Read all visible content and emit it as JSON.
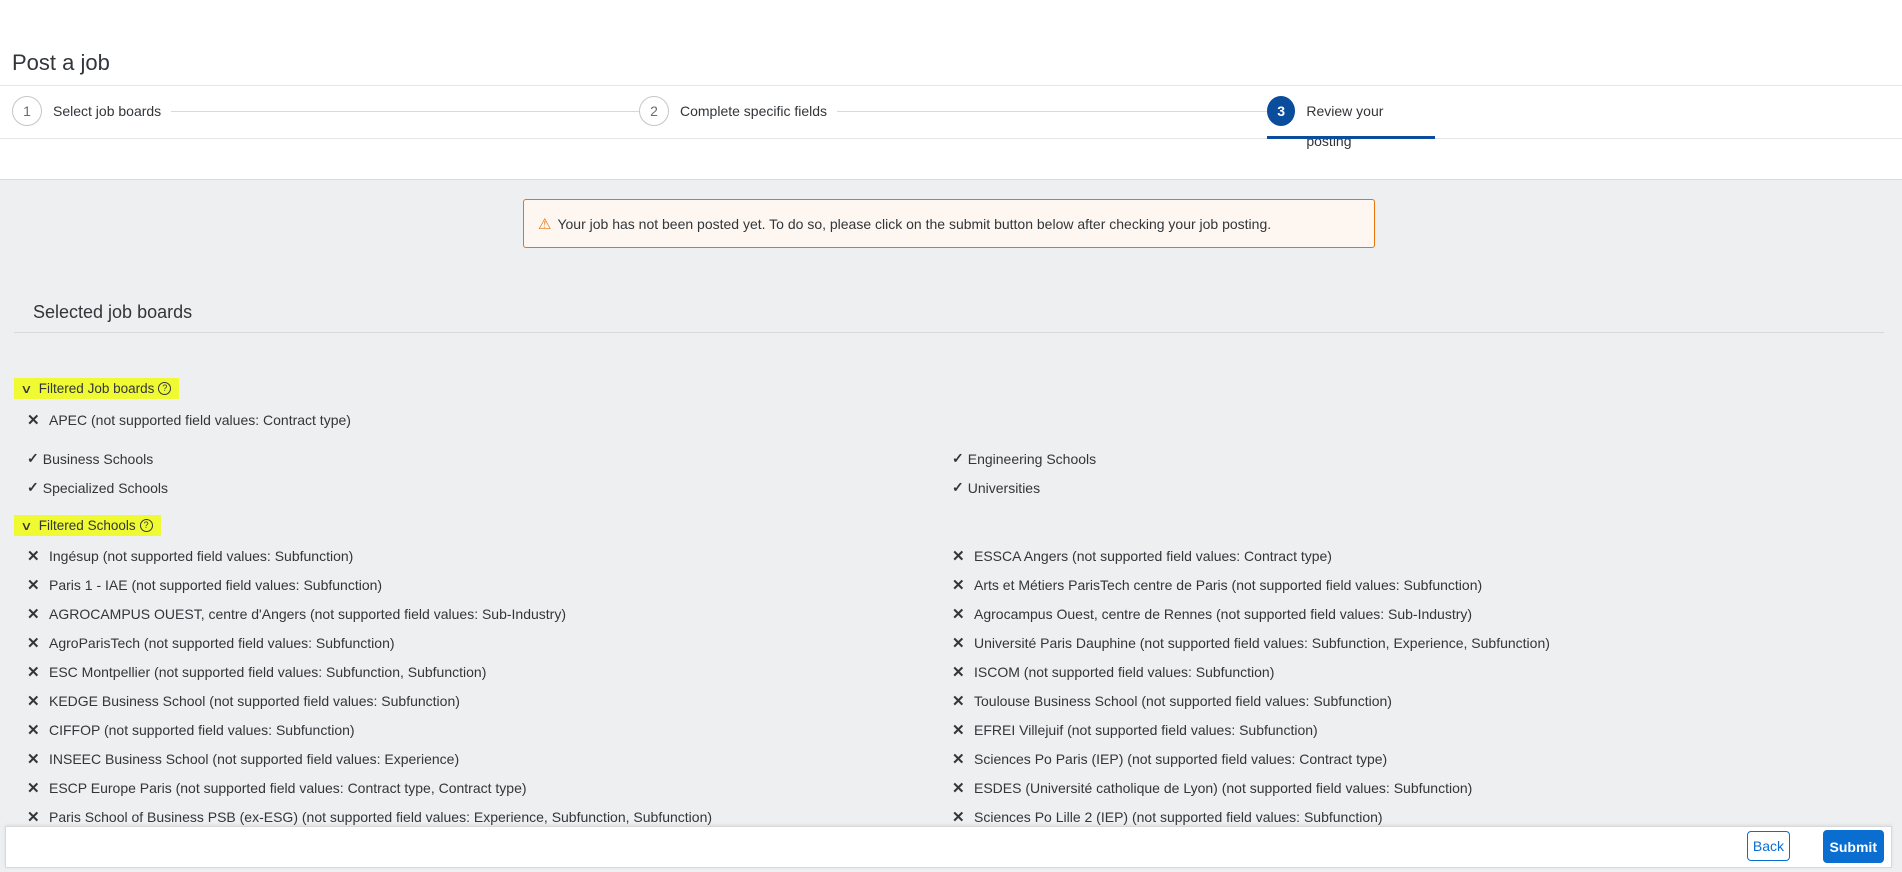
{
  "header": {
    "title": "Post a job"
  },
  "wizard": {
    "steps": [
      {
        "num": "1",
        "label": "Select job boards"
      },
      {
        "num": "2",
        "label": "Complete specific fields"
      },
      {
        "num": "3",
        "label": "Review your posting"
      }
    ],
    "active_step": 3
  },
  "warning": {
    "icon": "warning-triangle-icon",
    "text": "Your job has not been posted yet. To do so, please click on the submit button below after checking your job posting."
  },
  "section": {
    "title": "Selected job boards"
  },
  "filtered_job_boards": {
    "title": "Filtered Job boards",
    "items": [
      "APEC (not supported field values: Contract type)"
    ]
  },
  "school_categories": {
    "left": [
      "Business Schools",
      "Specialized Schools"
    ],
    "right": [
      "Engineering Schools",
      "Universities"
    ]
  },
  "filtered_schools": {
    "title": "Filtered Schools",
    "left": [
      "Ingésup (not supported field values: Subfunction)",
      "Paris 1 - IAE (not supported field values: Subfunction)",
      "AGROCAMPUS OUEST, centre d'Angers (not supported field values: Sub-Industry)",
      "AgroParisTech (not supported field values: Subfunction)",
      "ESC Montpellier (not supported field values: Subfunction, Subfunction)",
      "KEDGE Business School (not supported field values: Subfunction)",
      "CIFFOP (not supported field values: Subfunction)",
      "INSEEC Business School (not supported field values: Experience)",
      "ESCP Europe Paris (not supported field values: Contract type, Contract type)",
      "Paris School of Business PSB (ex-ESG) (not supported field values: Experience, Subfunction, Subfunction)"
    ],
    "right": [
      "ESSCA Angers (not supported field values: Contract type)",
      "Arts et Métiers ParisTech centre de Paris (not supported field values: Subfunction)",
      "Agrocampus Ouest, centre de Rennes (not supported field values: Sub-Industry)",
      "Université Paris Dauphine (not supported field values: Subfunction, Experience, Subfunction)",
      "ISCOM (not supported field values: Subfunction)",
      "Toulouse Business School (not supported field values: Subfunction)",
      "EFREI Villejuif (not supported field values: Subfunction)",
      "Sciences Po Paris (IEP) (not supported field values: Contract type)",
      "ESDES (Université catholique de Lyon) (not supported field values: Subfunction)",
      "Sciences Po Lille 2 (IEP) (not supported field values: Subfunction)"
    ]
  },
  "footer": {
    "back_label": "Back",
    "submit_label": "Submit"
  },
  "colors": {
    "accent": "#0a6ed1",
    "active_step": "#0a4d9c",
    "warning": "#e9730c",
    "highlight": "#f0fa32"
  }
}
